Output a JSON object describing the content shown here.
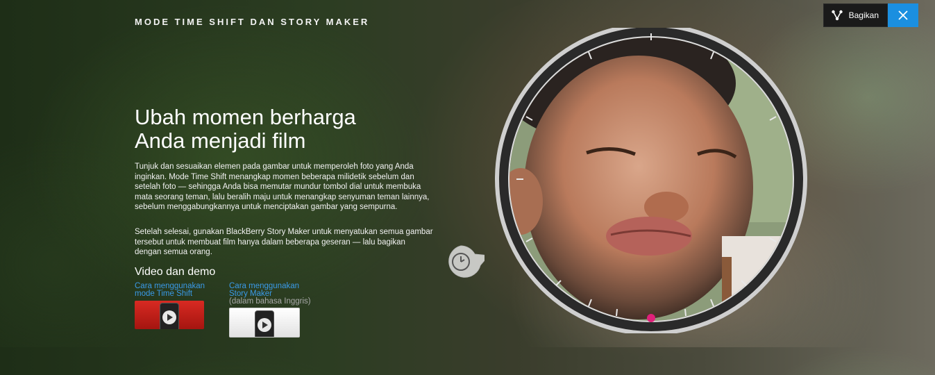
{
  "header": {
    "title": "MODE TIME SHIFT DAN STORY MAKER"
  },
  "share": {
    "label": "Bagikan",
    "icon": "share-icon"
  },
  "close": {
    "icon": "close-icon",
    "color": "#1b8fe0"
  },
  "hero": {
    "headline_line1": "Ubah momen berharga",
    "headline_line2": "Anda menjadi film",
    "paragraph1": "Tunjuk dan sesuaikan elemen pada gambar untuk memperoleh foto yang Anda inginkan. Mode Time Shift menangkap momen beberapa milidetik sebelum dan setelah foto — sehingga Anda bisa memutar mundur tombol dial untuk membuka mata seorang teman, lalu beralih maju untuk menangkap senyuman teman lainnya, sebelum menggabungkannya untuk menciptakan gambar yang sempurna.",
    "paragraph2": "Setelah selesai, gunakan BlackBerry Story Maker untuk menyatukan semua gambar tersebut untuk membuat film hanya dalam beberapa geseran — lalu bagikan dengan semua orang."
  },
  "videos": {
    "heading": "Video dan demo",
    "items": [
      {
        "line1": "Cara menggunakan",
        "line2": "mode Time Shift",
        "note": ""
      },
      {
        "line1": "Cara menggunakan",
        "line2": "Story Maker",
        "note": "(dalam bahasa Inggris)"
      }
    ]
  },
  "dial": {
    "icon": "clock-icon",
    "marker_color": "#e0207a"
  },
  "colors": {
    "accent": "#1b8fe0",
    "link": "#3a9ae8"
  }
}
